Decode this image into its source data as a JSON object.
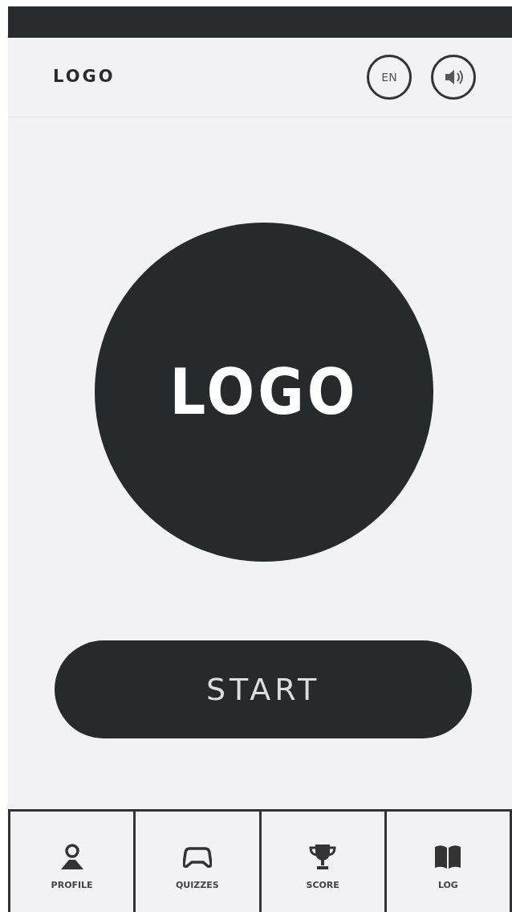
{
  "header": {
    "logo": "LOGO",
    "language": "EN"
  },
  "hero": {
    "logo": "LOGO"
  },
  "start_button": "START",
  "nav": [
    {
      "label": "PROFILE",
      "kind": "profile"
    },
    {
      "label": "QUIZZES",
      "kind": "quizzes"
    },
    {
      "label": "SCORE",
      "kind": "score"
    },
    {
      "label": "LOG",
      "kind": "log"
    }
  ]
}
